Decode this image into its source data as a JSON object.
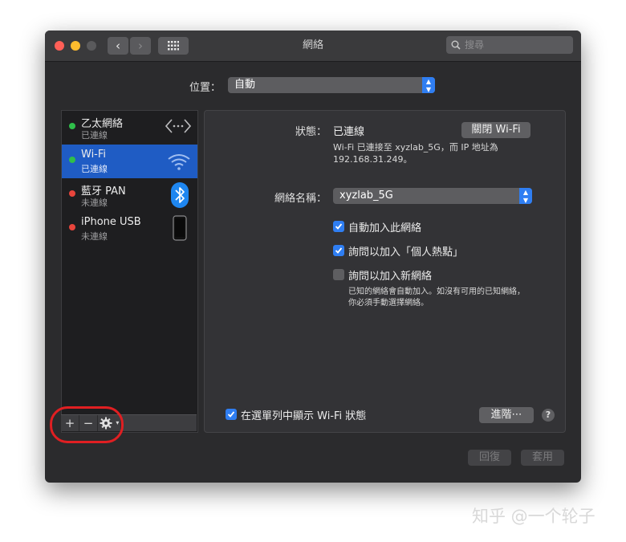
{
  "window": {
    "title": "網絡"
  },
  "toolbar": {
    "back_label": "‹",
    "forward_label": "›",
    "search_placeholder": "搜尋"
  },
  "location": {
    "label": "位置：",
    "value": "自動"
  },
  "services": [
    {
      "name": "乙太網絡",
      "status": "已連線",
      "status_color": "#2fbf4a",
      "icon": "ethernet-icon",
      "selected": false
    },
    {
      "name": "Wi-Fi",
      "status": "已連線",
      "status_color": "#2fbf4a",
      "icon": "wifi-icon",
      "selected": true
    },
    {
      "name": "藍牙 PAN",
      "status": "未連線",
      "status_color": "#e8453c",
      "icon": "bluetooth-icon",
      "selected": false
    },
    {
      "name": "iPhone USB",
      "status": "未連線",
      "status_color": "#e8453c",
      "icon": "iphone-icon",
      "selected": false
    }
  ],
  "sidebar_footer": {
    "add_label": "+",
    "remove_label": "−"
  },
  "detail": {
    "status_label": "狀態：",
    "status_value": "已連線",
    "toggle_wifi_label": "關閉 Wi-Fi",
    "status_desc_line1": "Wi-Fi 已連接至 xyzlab_5G，而 IP 地址為",
    "status_desc_line2": "192.168.31.249。",
    "network_name_label": "網絡名稱：",
    "network_name_value": "xyzlab_5G",
    "auto_join_label": "自動加入此網絡",
    "auto_join_checked": true,
    "ask_hotspot_label": "詢問以加入「個人熱點」",
    "ask_hotspot_checked": true,
    "ask_new_label": "詢問以加入新網絡",
    "ask_new_checked": false,
    "ask_new_desc_line1": "已知的網絡會自動加入。如沒有可用的已知網絡，",
    "ask_new_desc_line2": "你必須手動選擇網絡。",
    "show_menubar_label": "在選單列中顯示 Wi-Fi 狀態",
    "show_menubar_checked": true,
    "advanced_label": "進階⋯",
    "help_label": "?"
  },
  "footer": {
    "revert_label": "回復",
    "apply_label": "套用"
  },
  "watermark": "知乎 @一个轮子",
  "colors": {
    "accent": "#2f7ef2",
    "selection": "#1f5cc4",
    "highlight_circle": "#e01f22"
  }
}
